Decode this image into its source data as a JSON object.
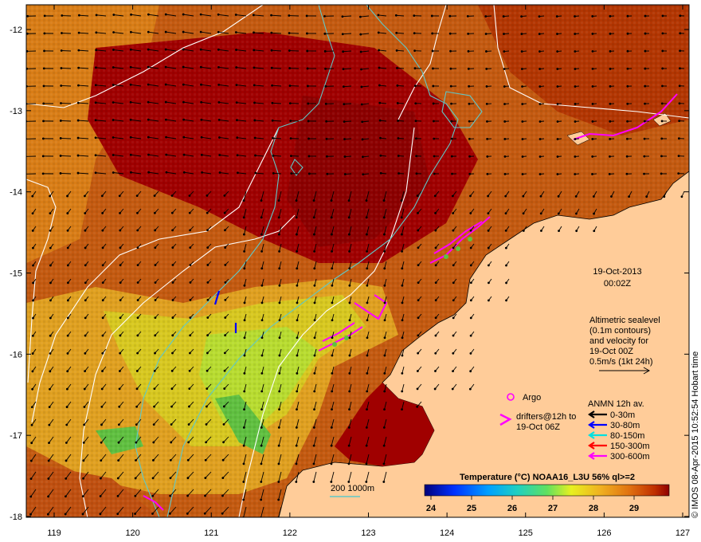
{
  "map": {
    "date": "19-Oct-2013",
    "time": "00:02Z",
    "altimetry_lines": [
      "Altimetric sealevel",
      "(0.1m contours)",
      "and velocity for",
      "19-Oct 00Z",
      "0.5m/s (1kt 24h)"
    ],
    "argo_label": "Argo",
    "drifters_lines": [
      "drifters@12h to",
      "19-Oct 06Z"
    ],
    "anmn_title": "ANMN 12h av.",
    "anmn_legend": [
      {
        "label": "0-30m",
        "color": "#000000"
      },
      {
        "label": "30-80m",
        "color": "#0000ff"
      },
      {
        "label": "80-150m",
        "color": "#00e0e0"
      },
      {
        "label": "150-300m",
        "color": "#ff0000"
      },
      {
        "label": "300-600m",
        "color": "#ff00ff"
      }
    ],
    "colorbar_title": "Temperature (°C) NOAA16_L3U 56% ql>=2",
    "colorbar_ticks": [
      "24",
      "25",
      "26",
      "27",
      "28",
      "29"
    ],
    "depth_legend": "200  1000m",
    "credit": "© IMOS 08-Apr-2015 10:52:54 Hobart time",
    "x_ticks": [
      "119",
      "120",
      "121",
      "122",
      "123",
      "124",
      "125",
      "126",
      "127"
    ],
    "y_ticks": [
      "-12",
      "-13",
      "-14",
      "-15",
      "-16",
      "-17",
      "-18"
    ],
    "colors": {
      "land": "#ffcc99",
      "ocean_dark": "#a00000",
      "ocean_mid": "#c45a10",
      "ocean_orange": "#e89b1a",
      "ocean_yellow": "#e8e81a",
      "ocean_green": "#70d040",
      "contour_white": "#ffffff",
      "bathy_cyan": "#5fc8c8",
      "drifter": "#ff00ff"
    }
  }
}
